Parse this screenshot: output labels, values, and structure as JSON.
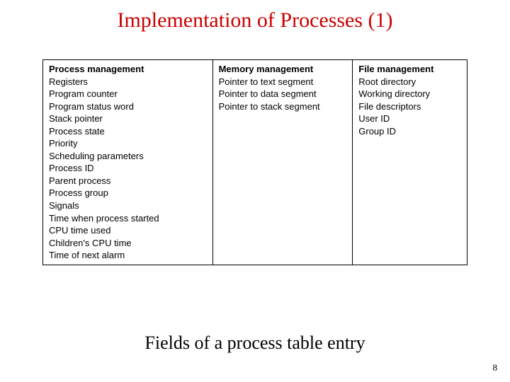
{
  "title": "Implementation of Processes (1)",
  "table": {
    "col1": {
      "header": "Process management",
      "rows": [
        "Registers",
        "Program counter",
        "Program status word",
        "Stack pointer",
        "Process state",
        "Priority",
        "Scheduling parameters",
        "Process ID",
        "Parent process",
        "Process group",
        "Signals",
        "Time when process started",
        "CPU time used",
        "Children's CPU time",
        "Time of next alarm"
      ]
    },
    "col2": {
      "header": "Memory management",
      "rows": [
        "Pointer to text segment",
        "Pointer to data segment",
        "Pointer to stack segment"
      ]
    },
    "col3": {
      "header": "File management",
      "rows": [
        "Root directory",
        "Working directory",
        "File descriptors",
        "User ID",
        "Group ID"
      ]
    }
  },
  "caption": "Fields of a process table entry",
  "page": "8"
}
